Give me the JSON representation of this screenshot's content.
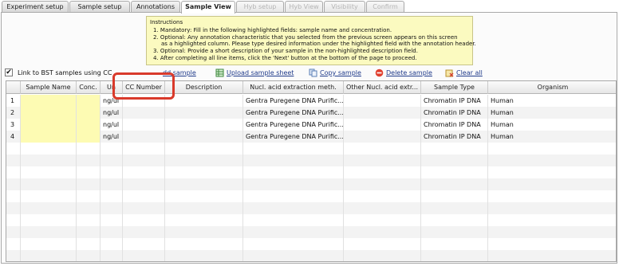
{
  "tabs": [
    {
      "label": "Experiment setup",
      "state": "normal"
    },
    {
      "label": "Sample setup",
      "state": "normal"
    },
    {
      "label": "Annotations",
      "state": "normal"
    },
    {
      "label": "Sample View",
      "state": "active"
    },
    {
      "label": "Hyb setup",
      "state": "disabled"
    },
    {
      "label": "Hyb View",
      "state": "disabled"
    },
    {
      "label": "Visibility",
      "state": "disabled"
    },
    {
      "label": "Confirm",
      "state": "disabled"
    }
  ],
  "instructions": {
    "title": "Instructions",
    "lines": [
      "1.  Mandatory: Fill in the following highlighted fields:  sample name and concentration.",
      "2.  Optional: Any annotation characteristic that you selected from the previous screen appears on this screen",
      "as a highlighted column. Please type desired information under the highlighted field with the annotation header.",
      "3.  Optional: Provide a short description of your sample in the non-highlighted description field.",
      "4.  After completing all line items, click the 'Next' button at the bottom of the page to proceed."
    ]
  },
  "toolbar": {
    "link_label": "Link to BST samples using CC",
    "add_sample": "dd sample",
    "upload_sheet": "Upload sample sheet",
    "copy_sample": "Copy sample",
    "delete_sample": "Delete sample",
    "clear_all": "Clear all"
  },
  "columns": [
    "",
    "Sample Name",
    "Conc.",
    "Un",
    "CC Number",
    "Description",
    "Nucl. acid extraction meth.",
    "Other Nucl. acid extr...",
    "Sample Type",
    "Organism"
  ],
  "rows": [
    {
      "num": "1",
      "name": "",
      "conc": "",
      "unit": "ng/ul",
      "cc": "",
      "desc": "",
      "method": "Gentra Puregene DNA Purific...",
      "other": "",
      "type": "Chromatin IP DNA",
      "organism": "Human"
    },
    {
      "num": "2",
      "name": "",
      "conc": "",
      "unit": "ng/ul",
      "cc": "",
      "desc": "",
      "method": "Gentra Puregene DNA Purific...",
      "other": "",
      "type": "Chromatin IP DNA",
      "organism": "Human"
    },
    {
      "num": "3",
      "name": "",
      "conc": "",
      "unit": "ng/ul",
      "cc": "",
      "desc": "",
      "method": "Gentra Puregene DNA Purific...",
      "other": "",
      "type": "Chromatin IP DNA",
      "organism": "Human"
    },
    {
      "num": "4",
      "name": "",
      "conc": "",
      "unit": "ng/ul",
      "cc": "",
      "desc": "",
      "method": "Gentra Puregene DNA Purific...",
      "other": "",
      "type": "Chromatin IP DNA",
      "organism": "Human"
    }
  ],
  "empty_row_count": 10,
  "colors": {
    "highlight_red": "#d93a2b",
    "mandatory_yellow": "#fdfbb3",
    "instructions_bg": "#fbfac0"
  }
}
